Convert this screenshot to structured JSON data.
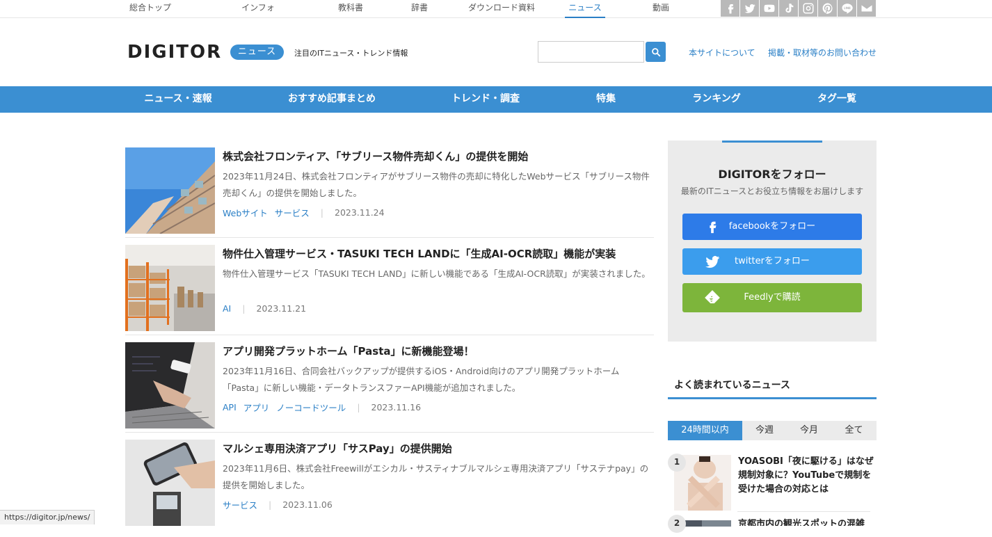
{
  "topnav": {
    "items": [
      "総合トップ",
      "インフォ",
      "教科書",
      "辞書",
      "ダウンロード資料",
      "ニュース",
      "動画"
    ],
    "active": "ニュース"
  },
  "social_icons": [
    "facebook-icon",
    "twitter-icon",
    "youtube-icon",
    "tiktok-icon",
    "instagram-icon",
    "pinterest-icon",
    "line-icon",
    "mail-icon"
  ],
  "header": {
    "logo": "DIGITOR",
    "badge": "ニュース",
    "tagline": "注目のITニュース・トレンド情報",
    "search_placeholder": "",
    "links": [
      "本サイトについて",
      "掲載・取材等のお問い合わせ"
    ]
  },
  "mainnav": [
    "ニュース・速報",
    "おすすめ記事まとめ",
    "トレンド・調査",
    "特集",
    "ランキング",
    "タグ一覧"
  ],
  "articles": [
    {
      "title": "株式会社フロンティア、「サブリース物件売却くん」の提供を開始",
      "excerpt": "2023年11月24日、株式会社フロンティアがサブリース物件の売却に特化したWebサービス「サブリース物件売却くん」の提供を開始しました。",
      "tags": [
        "Webサイト",
        "サービス"
      ],
      "date": "2023.11.24"
    },
    {
      "title": "物件仕入管理サービス・TASUKI TECH LANDに「生成AI-OCR読取」機能が実装",
      "excerpt": "物件仕入管理サービス「TASUKI TECH LAND」に新しい機能である「生成AI-OCR読取」が実装されました。",
      "tags": [
        "AI"
      ],
      "date": "2023.11.21"
    },
    {
      "title": "アプリ開発プラットホーム「Pasta」に新機能登場！",
      "excerpt": "2023年11月16日、合同会社バックアップが提供するiOS・Android向けのアプリ開発プラットホーム「Pasta」に新しい機能・データトランスファーAPI機能が追加されました。",
      "tags": [
        "API",
        "アプリ",
        "ノーコードツール"
      ],
      "date": "2023.11.16"
    },
    {
      "title": "マルシェ専用決済アプリ「サスPay」の提供開始",
      "excerpt": "2023年11月6日、株式会社Freewillがエシカル・サスティナブルマルシェ専用決済アプリ「サステナpay」の提供を開始しました。",
      "tags": [
        "サービス"
      ],
      "date": "2023.11.06"
    }
  ],
  "follow": {
    "title": "DIGITORをフォロー",
    "subtitle": "最新のITニュースとお役立ち情報をお届けします",
    "buttons": [
      {
        "label": "facebookをフォロー",
        "color": "#2d7be8"
      },
      {
        "label": "twitterをフォロー",
        "color": "#3b9ded"
      },
      {
        "label": "Feedlyで購読",
        "color": "#7db53b"
      }
    ]
  },
  "popular": {
    "title": "よく読まれているニュース",
    "tabs": [
      "24時間以内",
      "今週",
      "今月",
      "全て"
    ],
    "active_tab": "24時間以内",
    "items": [
      {
        "rank": "1",
        "title": "YOASOBI「夜に駆ける」はなぜ規制対象に？YouTubeで規制を受けた場合の対応とは"
      },
      {
        "rank": "2",
        "title": "京都市内の観光スポットの混雑"
      }
    ]
  },
  "status_url": "https://digitor.jp/news/",
  "colors": {
    "accent": "#3b8fd2",
    "link": "#2a7fc6"
  }
}
